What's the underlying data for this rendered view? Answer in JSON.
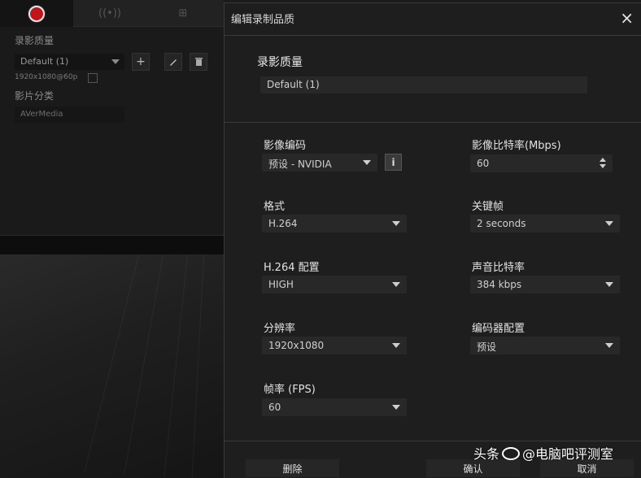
{
  "background_app": {
    "quality_label": "录影质量",
    "quality_value": "Default (1)",
    "resolution_text": "1920x1080@60p",
    "category_label": "影片分类",
    "category_value": "AVerMedia"
  },
  "dialog": {
    "title": "编辑录制品质",
    "close_glyph": "×",
    "quality_label": "录影质量",
    "quality_value": "Default (1)",
    "fields": {
      "video_encoder": {
        "label": "影像编码",
        "value": "预设 - NVIDIA",
        "info": "i"
      },
      "bitrate": {
        "label": "影像比特率(Mbps)",
        "value": "60"
      },
      "format": {
        "label": "格式",
        "value": "H.264"
      },
      "keyframe": {
        "label": "关键帧",
        "value": "2 seconds"
      },
      "h264_profile": {
        "label": "H.264 配置",
        "value": "HIGH"
      },
      "audio_bitrate": {
        "label": "声音比特率",
        "value": "384 kbps"
      },
      "resolution": {
        "label": "分辨率",
        "value": "1920x1080"
      },
      "encoder_profile": {
        "label": "编码器配置",
        "value": "预设"
      },
      "framerate": {
        "label": "帧率 (FPS)",
        "value": "60"
      }
    },
    "buttons": {
      "delete": "删除",
      "confirm": "确认",
      "cancel": "取消"
    }
  },
  "watermark": {
    "prefix": "头条",
    "text": "@电脑吧评测室"
  },
  "colors": {
    "record_red": "#c0161b",
    "dialog_bg": "#1e1e1e",
    "field_bg": "#282828"
  }
}
